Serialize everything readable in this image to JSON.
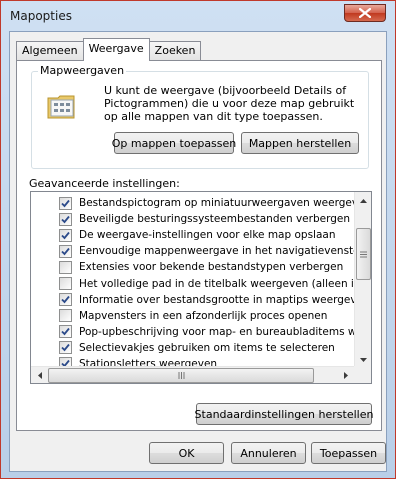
{
  "window": {
    "title": "Mapopties"
  },
  "tabs": [
    {
      "label": "Algemeen"
    },
    {
      "label": "Weergave"
    },
    {
      "label": "Zoeken"
    }
  ],
  "folder_views": {
    "group_label": "Mapweergaven",
    "description": "U kunt de weergave (bijvoorbeeld Details of Pictogrammen) die u voor deze map gebruikt op alle mappen van dit type toepassen.",
    "apply_button": "Op mappen toepassen",
    "reset_button": "Mappen herstellen"
  },
  "advanced": {
    "label": "Geavanceerde instellingen:",
    "items": [
      {
        "label": "Bestandspictogram op miniatuurweergaven weergeven",
        "checked": true
      },
      {
        "label": "Beveiligde besturingssysteembestanden verbergen (aanb",
        "checked": true
      },
      {
        "label": "De weergave-instellingen voor elke map opslaan",
        "checked": true
      },
      {
        "label": "Eenvoudige mappenweergave in het navigatievenster we",
        "checked": true
      },
      {
        "label": "Extensies voor bekende bestandstypen verbergen",
        "checked": false
      },
      {
        "label": "Het volledige pad in de titelbalk weergeven (alleen in klas",
        "checked": false
      },
      {
        "label": "Informatie over bestandsgrootte in maptips weergeven",
        "checked": true
      },
      {
        "label": "Mapvensters in een afzonderlijk proces openen",
        "checked": false
      },
      {
        "label": "Pop-upbeschrijving voor map- en bureaubladitems weerge",
        "checked": true
      },
      {
        "label": "Selectievakjes gebruiken om items te selecteren",
        "checked": true
      },
      {
        "label": "Stationsletters weergeven",
        "checked": true
      }
    ],
    "defaults_button": "Standaardinstellingen herstellen"
  },
  "footer": {
    "ok": "OK",
    "cancel": "Annuleren",
    "apply": "Toepassen"
  },
  "colors": {
    "close_button": "#c0391f",
    "window_frame": "#cfe0f3",
    "tab_border": "#898c95"
  }
}
